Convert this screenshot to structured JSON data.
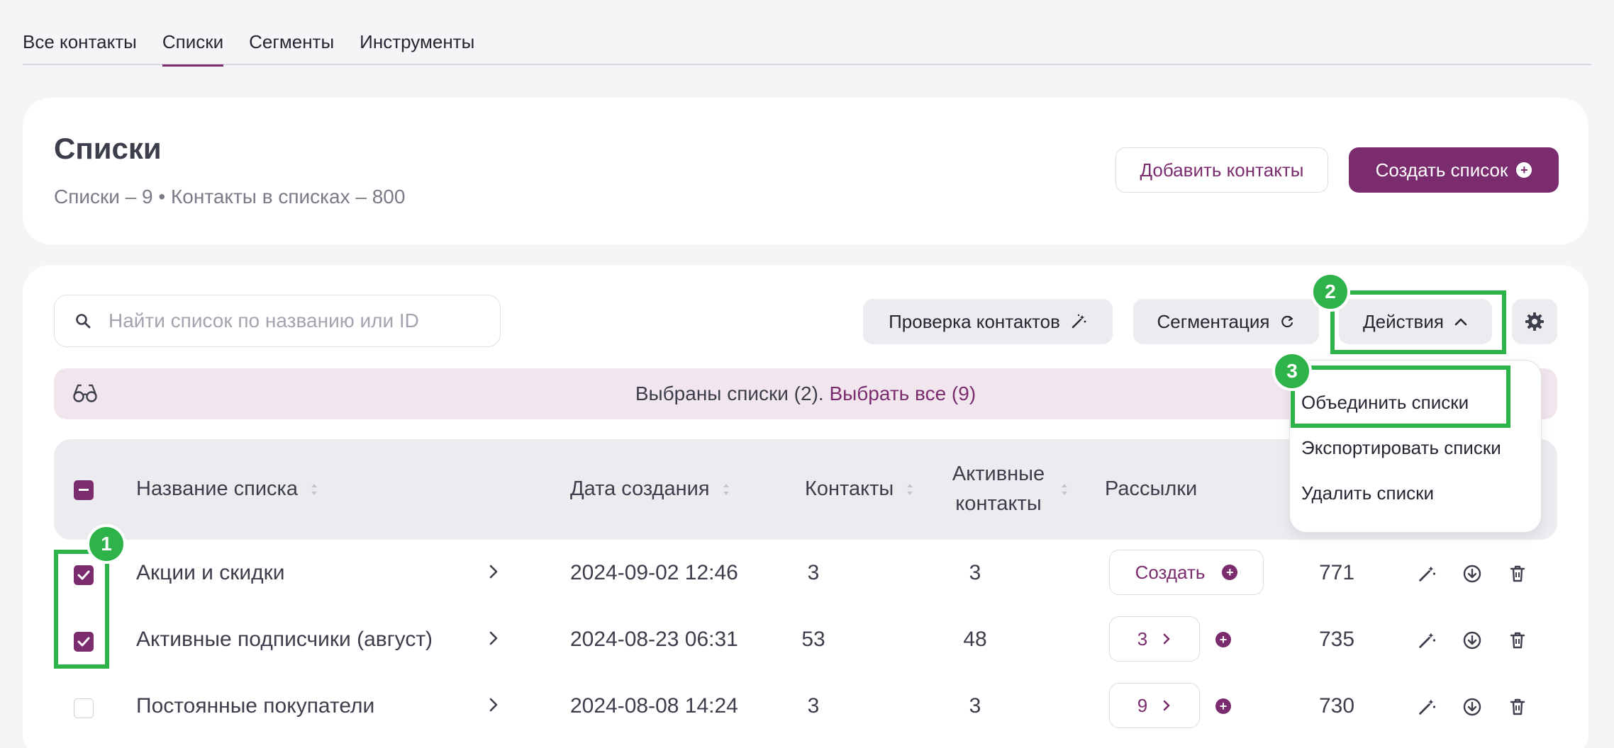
{
  "tabs": [
    {
      "label": "Все контакты"
    },
    {
      "label": "Списки"
    },
    {
      "label": "Сегменты"
    },
    {
      "label": "Инструменты"
    }
  ],
  "active_tab": "Списки",
  "header": {
    "title": "Списки",
    "subtitle": "Списки – 9 • Контакты в списках – 800",
    "add_contacts": "Добавить контакты",
    "create_list": "Создать список"
  },
  "toolbar": {
    "search_placeholder": "Найти список по названию или ID",
    "check_contacts": "Проверка контактов",
    "segmentation": "Сегментация",
    "actions": "Действия"
  },
  "selection": {
    "text": "Выбраны списки (2).",
    "select_all": "Выбрать все (9)"
  },
  "table": {
    "headers": {
      "name": "Название списка",
      "created": "Дата создания",
      "contacts": "Контакты",
      "active_line1": "Активные",
      "active_line2": "контакты",
      "mailings": "Рассылки"
    },
    "rows": [
      {
        "name": "Акции и скидки",
        "created": "2024-09-02 12:46",
        "contacts": "3",
        "active": "3",
        "mailings": "Создать",
        "id": "771",
        "checked": true
      },
      {
        "name": "Активные подписчики (август)",
        "created": "2024-08-23 06:31",
        "contacts": "53",
        "active": "48",
        "mailings": "3",
        "id": "735",
        "checked": true
      },
      {
        "name": "Постоянные покупатели",
        "created": "2024-08-08 14:24",
        "contacts": "3",
        "active": "3",
        "mailings": "9",
        "id": "730",
        "checked": false
      }
    ]
  },
  "dropdown": {
    "items": [
      "Объединить списки",
      "Экспортировать списки",
      "Удалить списки"
    ]
  },
  "annotations": [
    "1",
    "2",
    "3"
  ],
  "colors": {
    "accent": "#7b2c6e",
    "highlight": "#2db34a",
    "selected_bar": "#f1e6ee"
  }
}
